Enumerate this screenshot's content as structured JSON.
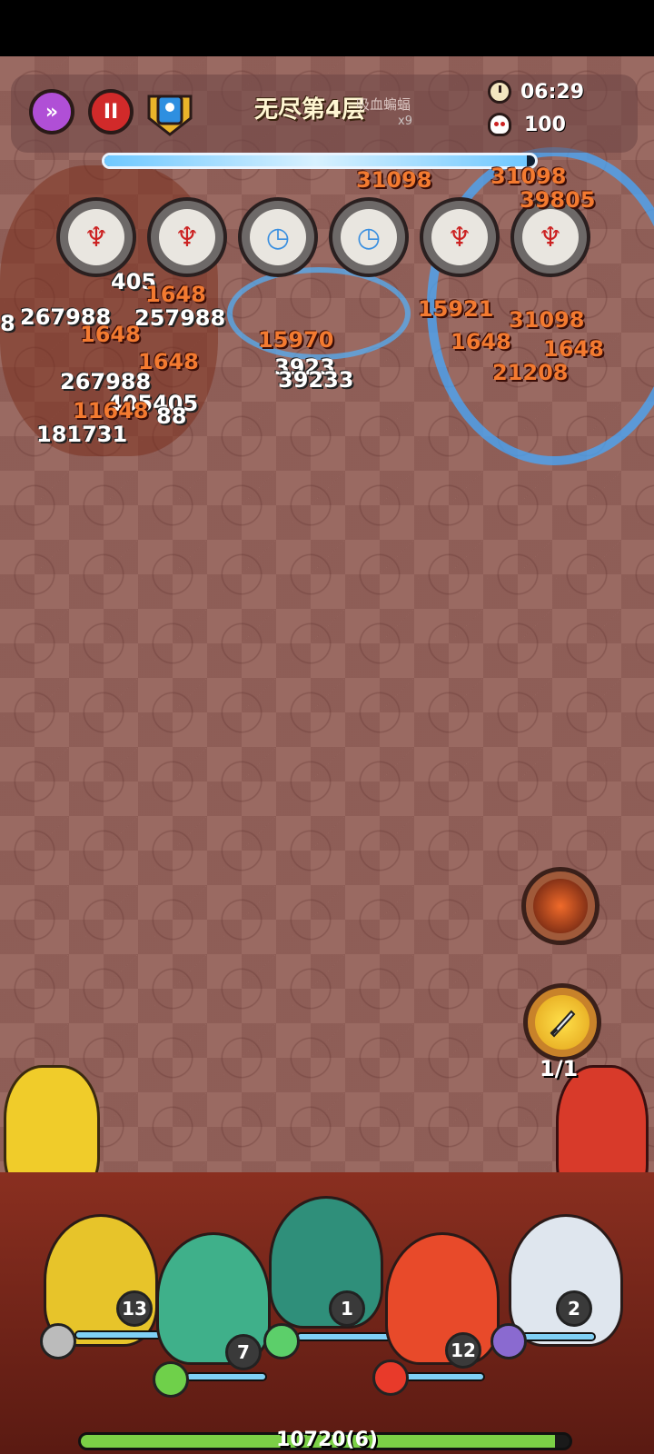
{
  "hud": {
    "stage_title": "无尽第4层",
    "boss_name": "吸血蝙蝠",
    "boss_count": "x9",
    "timer": "06:29",
    "kills": "100",
    "boss_hp_fraction": 0.98
  },
  "skills": [
    {
      "icon": "magnet-sword-icon",
      "color": "#c22"
    },
    {
      "icon": "magnet-sword-icon",
      "color": "#c22"
    },
    {
      "icon": "cooldown-clock-icon",
      "color": "#3a8fe0"
    },
    {
      "icon": "cooldown-clock-icon",
      "color": "#3a8fe0"
    },
    {
      "icon": "magnet-sword-icon",
      "color": "#c22"
    },
    {
      "icon": "magnet-sword-icon",
      "color": "#c22"
    }
  ],
  "damage_numbers": [
    {
      "text": "8",
      "style": "w"
    },
    {
      "text": "267988",
      "style": "w"
    },
    {
      "text": "405",
      "style": "w"
    },
    {
      "text": "1648",
      "style": "o"
    },
    {
      "text": "257988",
      "style": "w"
    },
    {
      "text": "1648",
      "style": "o"
    },
    {
      "text": "1648",
      "style": "o"
    },
    {
      "text": "267988",
      "style": "w"
    },
    {
      "text": "405405",
      "style": "w"
    },
    {
      "text": "11648",
      "style": "o"
    },
    {
      "text": "88",
      "style": "w"
    },
    {
      "text": "181731",
      "style": "w"
    },
    {
      "text": "15970",
      "style": "o"
    },
    {
      "text": "3923",
      "style": "w"
    },
    {
      "text": "39233",
      "style": "w"
    },
    {
      "text": "31098",
      "style": "o"
    },
    {
      "text": "31098",
      "style": "o"
    },
    {
      "text": "1648",
      "style": "o"
    },
    {
      "text": "1648",
      "style": "o"
    },
    {
      "text": "21208",
      "style": "o"
    },
    {
      "text": "15921",
      "style": "o"
    },
    {
      "text": "31098",
      "style": "o"
    },
    {
      "text": "39805",
      "style": "o"
    }
  ],
  "side_skills": {
    "ultimate_icon": "demon-face-icon",
    "item_icon": "sword-icon",
    "item_count": "1/1"
  },
  "heroes": [
    {
      "name": "yellow-bomber",
      "level": "13",
      "element": "wind-icon"
    },
    {
      "name": "green-deer-mage",
      "level": "7",
      "element": "tornado-icon"
    },
    {
      "name": "blue-ghost",
      "level": "1",
      "element": "wave-icon"
    },
    {
      "name": "fire-monk",
      "level": "12",
      "element": "fire-ring-icon"
    },
    {
      "name": "old-sage",
      "level": "2",
      "element": "moon-icon"
    }
  ],
  "base": {
    "label": "10720(6)",
    "hp_fraction": 0.97
  }
}
